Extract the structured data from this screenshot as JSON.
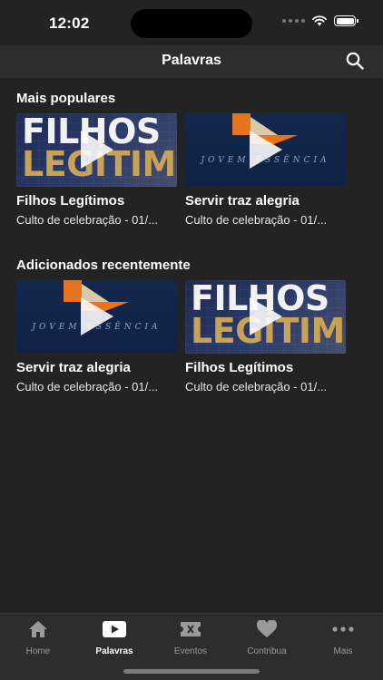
{
  "status": {
    "time": "12:02"
  },
  "nav": {
    "title": "Palavras"
  },
  "sections": [
    {
      "title": "Mais populares",
      "items": [
        {
          "thumb": "filhos",
          "thumb_line1": "FILHOS",
          "thumb_line2": "LEGÍTIMOS",
          "title": "Filhos Legítimos",
          "subtitle": "Culto de celebração - 01/..."
        },
        {
          "thumb": "jovem",
          "thumb_text": "JOVEM ESSÊNCIA",
          "title": "Servir traz alegria",
          "subtitle": "Culto de celebração - 01/..."
        }
      ]
    },
    {
      "title": "Adicionados recentemente",
      "items": [
        {
          "thumb": "jovem",
          "thumb_text": "JOVEM ESSÊNCIA",
          "title": "Servir traz alegria",
          "subtitle": "Culto de celebração - 01/..."
        },
        {
          "thumb": "filhos",
          "thumb_line1": "FILHOS",
          "thumb_line2": "LEGÍTIMOS",
          "title": "Filhos Legítimos",
          "subtitle": "Culto de celebração - 01/..."
        }
      ]
    }
  ],
  "tabs": [
    {
      "label": "Home",
      "icon": "house-icon",
      "active": false
    },
    {
      "label": "Palavras",
      "icon": "play-video-icon",
      "active": true
    },
    {
      "label": "Eventos",
      "icon": "ticket-icon",
      "active": false
    },
    {
      "label": "Contribua",
      "icon": "heart-icon",
      "active": false
    },
    {
      "label": "Mais",
      "icon": "more-dots-icon",
      "active": false
    }
  ],
  "colors": {
    "background": "#232323",
    "bar": "#2d2d2d",
    "gold": "#c9a25a",
    "orange": "#e8731f",
    "navy": "#13284d"
  }
}
